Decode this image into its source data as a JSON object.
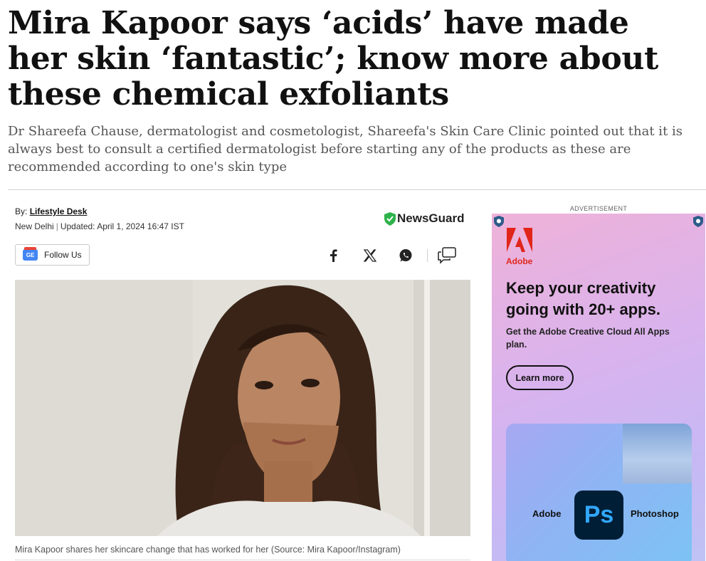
{
  "article": {
    "headline": "Mira Kapoor says ‘acids’ have made her skin ‘fantastic’; know more about these chemical exfoliants",
    "subhead": "Dr Shareefa Chause, dermatologist and cosmetologist, Shareefa's Skin Care Clinic pointed out that it is always best to consult a certified dermatologist before starting any of the products as these are recommended according to one's skin type",
    "byline_prefix": "By:",
    "author": "Lifestyle Desk",
    "location": "New Delhi",
    "updated": "Updated: April 1, 2024 16:47 IST",
    "newsguard": "NewsGuard",
    "follow_label": "Follow Us",
    "follow_icon_text": "GE",
    "share_icons": [
      "facebook-icon",
      "x-icon",
      "whatsapp-icon",
      "comments-icon"
    ],
    "image_caption": "Mira Kapoor shares her skincare change that has worked for her (Source: Mira Kapoor/Instagram)"
  },
  "ad": {
    "label": "ADVERTISEMENT",
    "brand": "Adobe",
    "title": "Keep your creativity going with 20+ apps.",
    "subtitle": "Get the Adobe Creative Cloud All Apps plan.",
    "cta": "Learn more",
    "card_left_label": "Adobe",
    "card_right_label": "Photoshop",
    "app_icon_text": "Ps"
  },
  "colors": {
    "adobe_red": "#e1251b",
    "newsguard_green": "#2eb24a",
    "ps_blue": "#31a8ff"
  }
}
